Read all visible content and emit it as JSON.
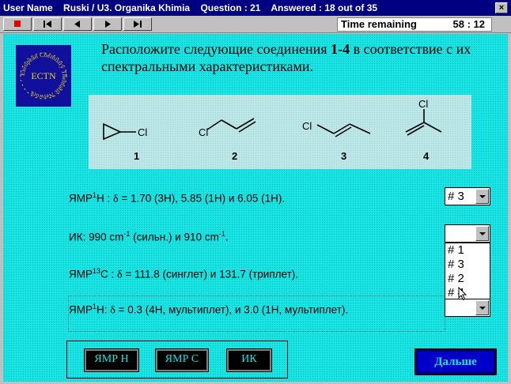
{
  "titlebar": {
    "user": "User Name",
    "course": "Ruski / U3. Organika Khimia",
    "question": "Question : 21",
    "answered": "Answered : 18 out of 35",
    "close": "×"
  },
  "timer": {
    "label": "Time remaining",
    "value": "58 : 12"
  },
  "question": {
    "before": "Расположите следующие соединения ",
    "bold": "1-4",
    "after": " в соответствие с их спектральными характеристиками."
  },
  "logo": {
    "ring_text": "European Chemistry Thematic Network",
    "center": "ECTN"
  },
  "structures": {
    "cl": "Cl",
    "labels": [
      "1",
      "2",
      "3",
      "4"
    ]
  },
  "clues": [
    {
      "p1": "ЯМР",
      "sup": "1",
      "p2": "H : ",
      "ser": "δ",
      "p3": " = 1.70 (3H), 5.85 (1H) и 6.05 (1H)."
    },
    {
      "p1": "ИК:  990 cm",
      "sup": "-1",
      "p2": " (сильн.) и 910 cm",
      "sup2": "-1",
      "p3": "."
    },
    {
      "p1": "ЯМР",
      "sup": "13",
      "p2": "C : ",
      "ser": "δ",
      "p3": " = 111.8 (синглет) и 131.7 (триплет)."
    },
    {
      "p1": "ЯМР",
      "sup": "1",
      "p2": "H: ",
      "ser": "δ",
      "p3": " = 0.3 (4H, мультиплет), и 3.0 (1H, мультиплет)."
    }
  ],
  "selects": {
    "first_value": "# 3",
    "second_value": "",
    "fourth_value": ""
  },
  "dropdown_options": [
    "# 1",
    "# 3",
    "# 2",
    "# 4"
  ],
  "buttons": {
    "nmr_h": "ЯМР H",
    "nmr_c": "ЯМР C",
    "ir": "ИК",
    "next": "Дальше"
  }
}
